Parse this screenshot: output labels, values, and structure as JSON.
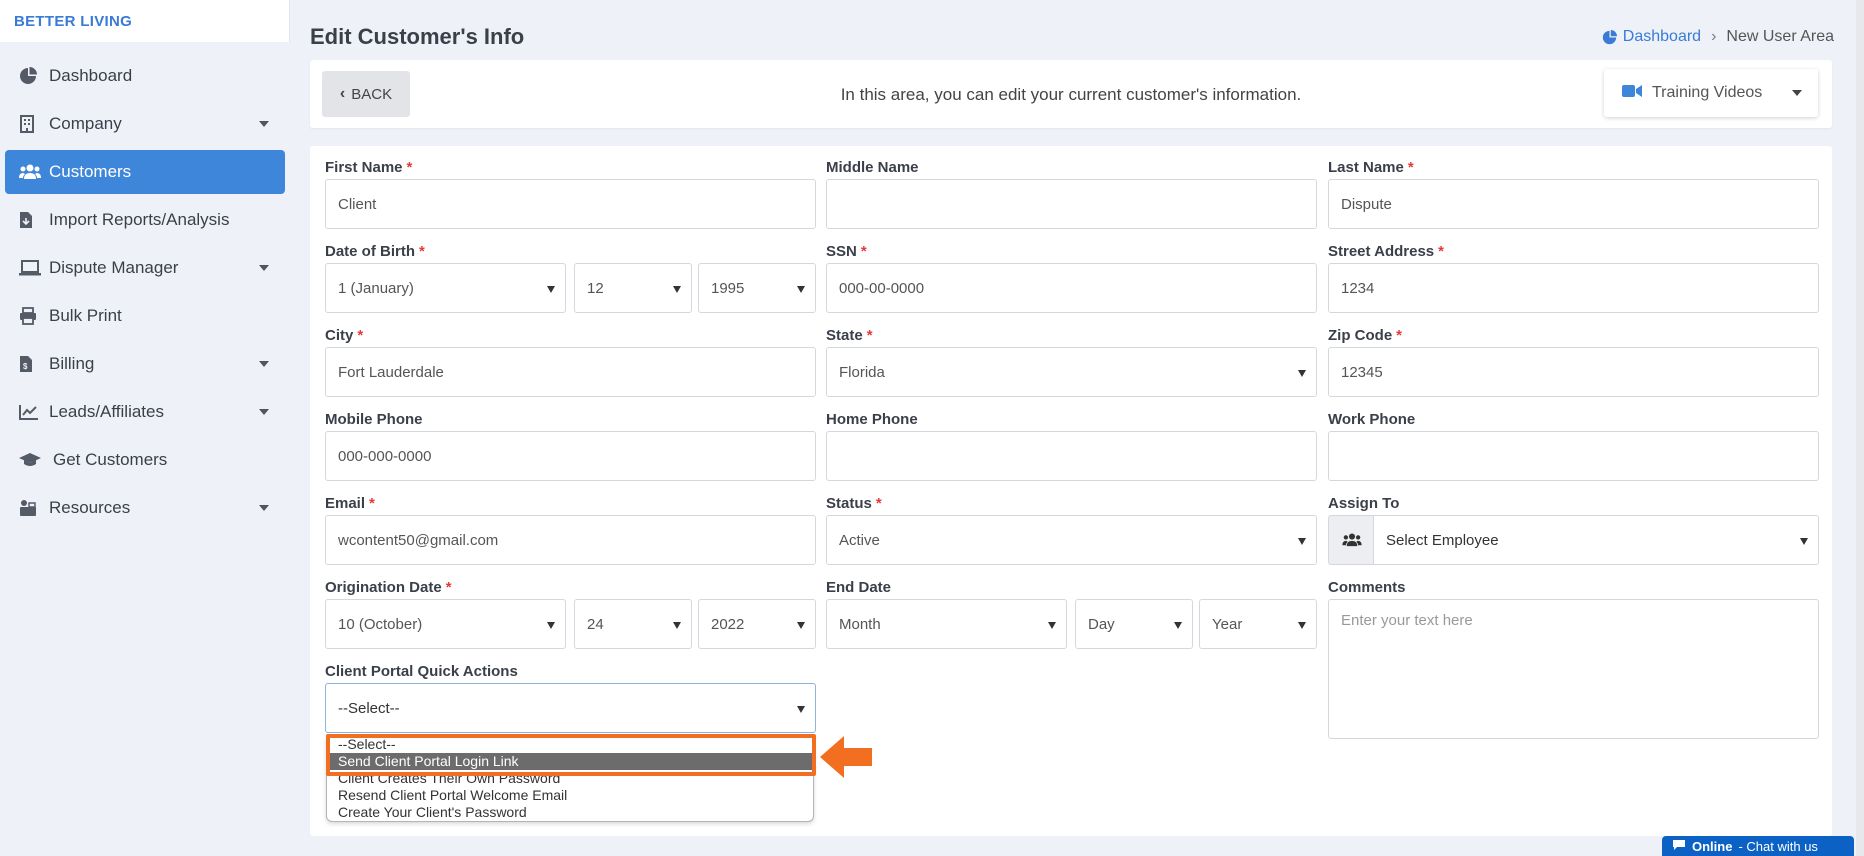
{
  "brand": "BETTER LIVING",
  "sidebar": {
    "items": [
      {
        "label": "Dashboard"
      },
      {
        "label": "Company"
      },
      {
        "label": "Customers"
      },
      {
        "label": "Import Reports/Analysis"
      },
      {
        "label": "Dispute Manager"
      },
      {
        "label": "Bulk Print"
      },
      {
        "label": "Billing"
      },
      {
        "label": "Leads/Affiliates"
      },
      {
        "label": "Get Customers"
      },
      {
        "label": "Resources"
      }
    ]
  },
  "header": {
    "title": "Edit Customer's Info",
    "breadcrumb": {
      "home": "Dashboard",
      "current": "New User Area"
    }
  },
  "topbar": {
    "back_label": "BACK",
    "intro": "In this area, you can edit your current customer's information.",
    "training_videos": "Training Videos"
  },
  "form": {
    "first_name": {
      "label": "First Name",
      "value": "Client"
    },
    "middle_name": {
      "label": "Middle Name",
      "value": ""
    },
    "last_name": {
      "label": "Last Name",
      "value": "Dispute"
    },
    "dob": {
      "label": "Date of Birth",
      "month": "1 (January)",
      "day": "12",
      "year": "1995"
    },
    "ssn": {
      "label": "SSN",
      "value": "000-00-0000"
    },
    "street": {
      "label": "Street Address",
      "value": "1234"
    },
    "city": {
      "label": "City",
      "value": "Fort Lauderdale"
    },
    "state": {
      "label": "State",
      "value": "Florida"
    },
    "zip": {
      "label": "Zip Code",
      "value": "12345"
    },
    "mobile": {
      "label": "Mobile Phone",
      "value": "000-000-0000"
    },
    "home_phone": {
      "label": "Home Phone",
      "value": ""
    },
    "work_phone": {
      "label": "Work Phone",
      "value": ""
    },
    "email": {
      "label": "Email",
      "value": "wcontent50@gmail.com"
    },
    "status": {
      "label": "Status",
      "value": "Active"
    },
    "assign": {
      "label": "Assign To",
      "value": "Select Employee"
    },
    "origination": {
      "label": "Origination Date",
      "month": "10 (October)",
      "day": "24",
      "year": "2022"
    },
    "end_date": {
      "label": "End Date",
      "month": "Month",
      "day": "Day",
      "year": "Year"
    },
    "comments": {
      "label": "Comments",
      "placeholder": "Enter your text here"
    },
    "quick_actions": {
      "label": "Client Portal Quick Actions",
      "value": "--Select--",
      "options": [
        "--Select--",
        "Send Client Portal Login Link",
        "Client Creates Their Own Password",
        "Resend Client Portal Welcome Email",
        "Create Your Client's Password"
      ]
    }
  },
  "chat": {
    "status": "Online",
    "text": "- Chat with us"
  },
  "colors": {
    "accent": "#3d86d9",
    "highlight": "#f26f21",
    "required": "#e23a3a"
  }
}
